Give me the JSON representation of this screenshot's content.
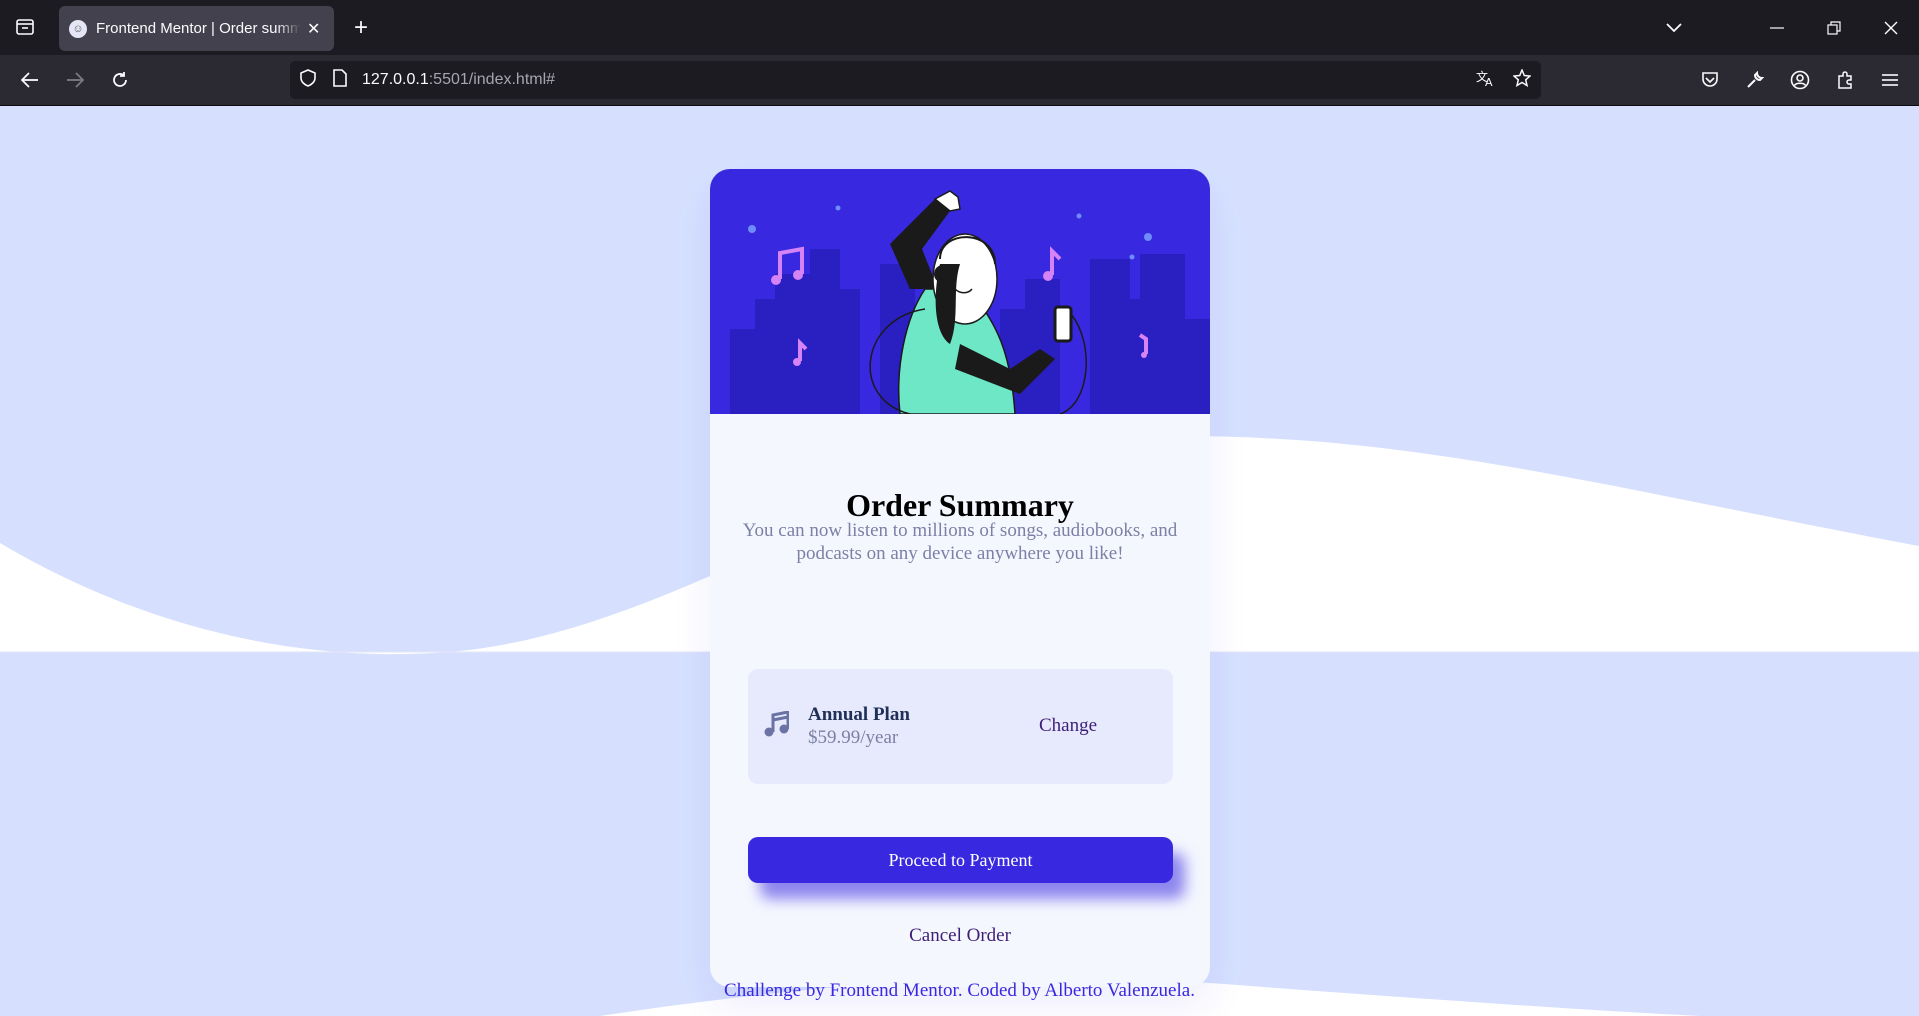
{
  "browser": {
    "tab_title": "Frontend Mentor | Order summary card",
    "url_host": "127.0.0.1",
    "url_rest": ":5501/index.html#"
  },
  "card": {
    "title": "Order Summary",
    "description": "You can now listen to millions of songs, audiobooks, and podcasts on any device anywhere you like!",
    "plan": {
      "name": "Annual Plan",
      "price": "$59.99/year",
      "change_label": "Change",
      "icon": "music-note-icon"
    },
    "pay_label": "Proceed to Payment",
    "cancel_label": "Cancel Order"
  },
  "footer": {
    "prefix": "Challenge by ",
    "mentor_link": "Frontend Mentor",
    "middle": ". Coded by ",
    "author_link": "Alberto Valenzuela",
    "suffix": "."
  },
  "colors": {
    "page_bg": "#d6e0fe",
    "wave": "#ffffff",
    "primary": "#3829e0",
    "dark_text": "#1f2f56",
    "muted_text": "#7c80a5",
    "hero_bg": "#3829e0"
  }
}
